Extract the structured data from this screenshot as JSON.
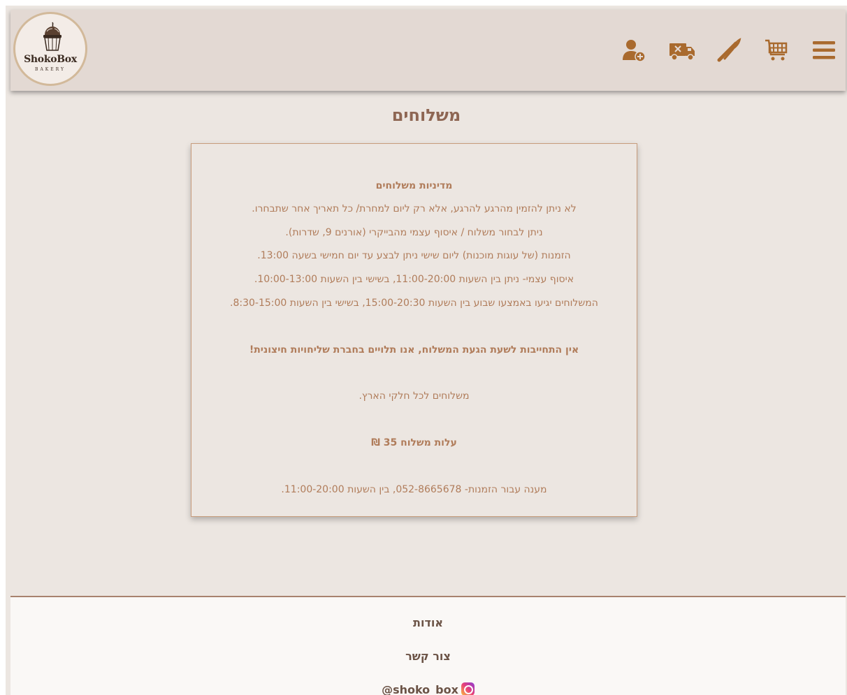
{
  "header": {
    "logo": {
      "name": "ShokoBox",
      "subtitle": "BAKERY"
    },
    "nav": [
      {
        "icon": "menu-icon"
      },
      {
        "icon": "cart-icon"
      },
      {
        "icon": "whisk-rolling-pin-icon"
      },
      {
        "icon": "delivery-truck-icon"
      },
      {
        "icon": "add-user-icon"
      }
    ],
    "icon_color": "#a96a2e"
  },
  "main": {
    "title": "משלוחים",
    "policy": {
      "heading": "מדיניות משלוחים",
      "lines": [
        "לא ניתן להזמין מהרגע להרגע, אלא רק ליום למחרת/ כל תאריך אחר שתבחרו.",
        "ניתן לבחור משלוח / איסוף עצמי מהבייקרי (אורנים 9, שדרות).",
        "הזמנות (של עוגות מוכנות) ליום שישי ניתן לבצע עד יום חמישי בשעה 13:00.",
        "איסוף עצמי- ניתן בין השעות 11:00-20:00, בשישי בין השעות 10:00-13:00.",
        "המשלוחים יגיעו באמצעו שבוע בין השעות 15:00-20:30, בשישי בין השעות 8:30-15:00."
      ],
      "disclaimer": "אין התחייבות לשעת הגעת המשלוח, אנו תלויים בחברת שליחויות חיצונית!",
      "coverage": "משלוחים לכל חלקי הארץ.",
      "cost": "עלות משלוח 35 ₪",
      "contact": "מענה עבור הזמנות- 052-8665678, בין השעות 11:00-20:00."
    }
  },
  "footer": {
    "about": "אודות",
    "contact": "צור קשר",
    "instagram": "@shoko_box",
    "instagram_icon": "instagram-icon"
  },
  "colors": {
    "background": "#ece6e1",
    "header": "#e3d9d3",
    "title": "#8e6653",
    "text": "#b07c5a",
    "footer_text": "#6b5346"
  }
}
